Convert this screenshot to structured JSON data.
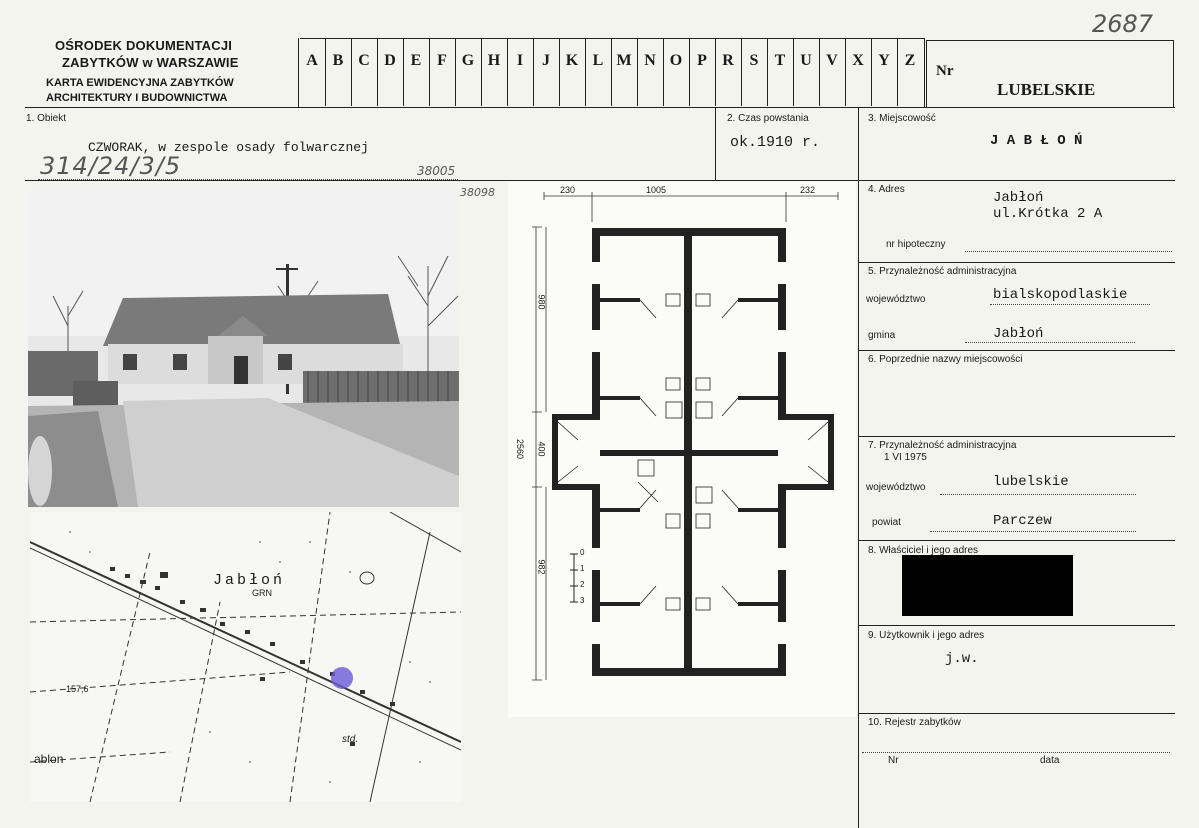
{
  "header": {
    "institution_line1": "OŚRODEK DOKUMENTACJI",
    "institution_line2": "ZABYTKÓW w WARSZAWIE",
    "card_line1": "KARTA EWIDENCYJNA ZABYTKÓW",
    "card_line2": "ARCHITEKTURY I BUDOWNICTWA",
    "letters": [
      "A",
      "B",
      "C",
      "D",
      "E",
      "F",
      "G",
      "H",
      "I",
      "J",
      "K",
      "L",
      "M",
      "N",
      "O",
      "P",
      "R",
      "S",
      "T",
      "U",
      "V",
      "X",
      "Y",
      "Z"
    ],
    "nr_label": "Nr",
    "region": "LUBELSKIE",
    "handwritten_number": "2687"
  },
  "fields": {
    "obiekt_label": "1. Obiekt",
    "obiekt_value": "CZWORAK, w zespole osady folwarcznej",
    "obiekt_handwritten": "314/24/3/5",
    "obiekt_code": "38005",
    "photo_code": "38098",
    "czas_label": "2. Czas powstania",
    "czas_value": "ok.1910 r.",
    "miejscowosc_label": "3. Miejscowość",
    "miejscowosc_value": "J A B Ł O Ń",
    "adres_label": "4. Adres",
    "adres_line1": "Jabłoń",
    "adres_line2": "ul.Krótka 2 A",
    "hipoteczny_label": "nr hipoteczny",
    "przyn5_label": "5. Przynależność administracyjna",
    "woj5_label": "województwo",
    "woj5_value": "bialskopodlaskie",
    "gmina_label": "gmina",
    "gmina_value": "Jabłoń",
    "poprzednie_label": "6. Poprzednie nazwy miejscowości",
    "przyn7_label": "7. Przynależność administracyjna",
    "przyn7_date": "1 VI 1975",
    "woj7_label": "województwo",
    "woj7_value": "lubelskie",
    "powiat_label": "powiat",
    "powiat_value": "Parczew",
    "wlasciciel_label": "8. Właściciel i jego adres",
    "uzytkownik_label": "9. Użytkownik i jego adres",
    "uzytkownik_value": "j.w.",
    "rejestr_label": "10. Rejestr zabytków",
    "rejestr_nr_label": "Nr",
    "rejestr_data_label": "data"
  },
  "plan": {
    "dim_top_left": "230",
    "dim_top_mid": "1005",
    "dim_top_right": "232",
    "dim_left_1": "980",
    "dim_left_2": "400",
    "dim_left_total": "2560",
    "dim_left_3": "982",
    "scale_labels": [
      "0",
      "1",
      "2",
      "3"
    ]
  },
  "map": {
    "town_label": "Jabłoń",
    "grn_label": "GRN",
    "height_label": "157,6",
    "std_label": "std.",
    "town_label_left": "ablon"
  }
}
